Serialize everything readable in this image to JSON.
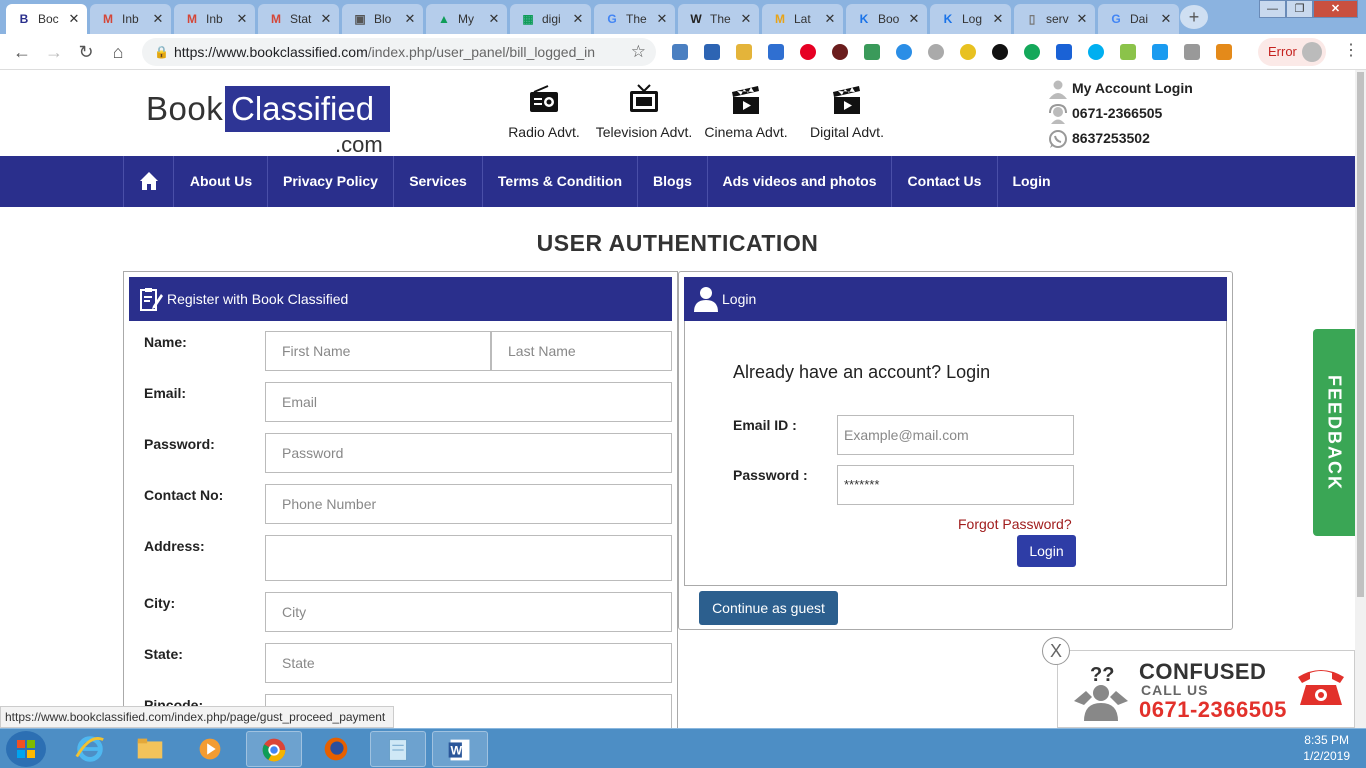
{
  "browser": {
    "tabs": [
      {
        "title": "Boc",
        "fav": "B",
        "favcolor": "#2a2f8c",
        "active": true
      },
      {
        "title": "Inb",
        "fav": "M",
        "favcolor": "#d44638"
      },
      {
        "title": "Inb",
        "fav": "M",
        "favcolor": "#d44638"
      },
      {
        "title": "Stat",
        "fav": "M",
        "favcolor": "#d44638"
      },
      {
        "title": "Blo",
        "fav": "▣",
        "favcolor": "#555"
      },
      {
        "title": "My",
        "fav": "▲",
        "favcolor": "#0f9d58"
      },
      {
        "title": "digi",
        "fav": "▦",
        "favcolor": "#0f9d58"
      },
      {
        "title": "The",
        "fav": "G",
        "favcolor": "#4285f4"
      },
      {
        "title": "The",
        "fav": "W",
        "favcolor": "#222"
      },
      {
        "title": "Lat",
        "fav": "M",
        "favcolor": "#e8a317"
      },
      {
        "title": "Boo",
        "fav": "K",
        "favcolor": "#1a73e8"
      },
      {
        "title": "Log",
        "fav": "K",
        "favcolor": "#1a73e8"
      },
      {
        "title": "serv",
        "fav": "▯",
        "favcolor": "#777"
      },
      {
        "title": "Dai",
        "fav": "G",
        "favcolor": "#4285f4"
      }
    ],
    "url_host": "https://www.bookclassified.com",
    "url_path": "/index.php/user_panel/bill_logged_in",
    "error_label": "Error"
  },
  "header": {
    "logo_book": "Book",
    "logo_classified": "Classified",
    "logo_com": ".com",
    "media": [
      {
        "label": "Radio Advt.",
        "icon": "radio-icon"
      },
      {
        "label": "Television Advt.",
        "icon": "tv-icon"
      },
      {
        "label": "Cinema Advt.",
        "icon": "clapper-icon"
      },
      {
        "label": "Digital Advt.",
        "icon": "clapper-icon"
      }
    ],
    "account_login": "My Account Login",
    "phone": "0671-2366505",
    "whatsapp": "8637253502"
  },
  "nav": {
    "items": [
      "About Us",
      "Privacy Policy",
      "Services",
      "Terms & Condition",
      "Blogs",
      "Ads videos and photos",
      "Contact Us",
      "Login"
    ]
  },
  "page_title": "USER AUTHENTICATION",
  "register": {
    "title": "Register with Book Classified",
    "labels": {
      "name": "Name:",
      "email": "Email:",
      "password": "Password:",
      "contact": "Contact No:",
      "address": "Address:",
      "city": "City:",
      "state": "State:",
      "pincode": "Pincode:"
    },
    "placeholders": {
      "first": "First Name",
      "last": "Last Name",
      "email": "Email",
      "password": "Password",
      "phone": "Phone Number",
      "city": "City",
      "state": "State"
    }
  },
  "login": {
    "title": "Login",
    "lead": "Already have an account? Login",
    "email_label": "Email ID :",
    "email_placeholder": "Example@mail.com",
    "password_label": "Password :",
    "password_value": "*******",
    "forgot": "Forgot Password?",
    "button": "Login",
    "guest": "Continue as guest"
  },
  "feedback": "FEEDBACK",
  "confused": {
    "close": "X",
    "line1": "CONFUSED",
    "line2": "CALL US",
    "line3": "0671-2366505"
  },
  "status_link": "https://www.bookclassified.com/index.php/page/gust_proceed_payment",
  "taskbar": {
    "time": "8:35 PM",
    "date": "1/2/2019"
  },
  "colors": {
    "brand_navy": "#2a2f8c",
    "feedback_green": "#3aa655",
    "guest_blue": "#2c5f8e",
    "forgot_red": "#a01c1c",
    "phone_red": "#e2312b"
  }
}
